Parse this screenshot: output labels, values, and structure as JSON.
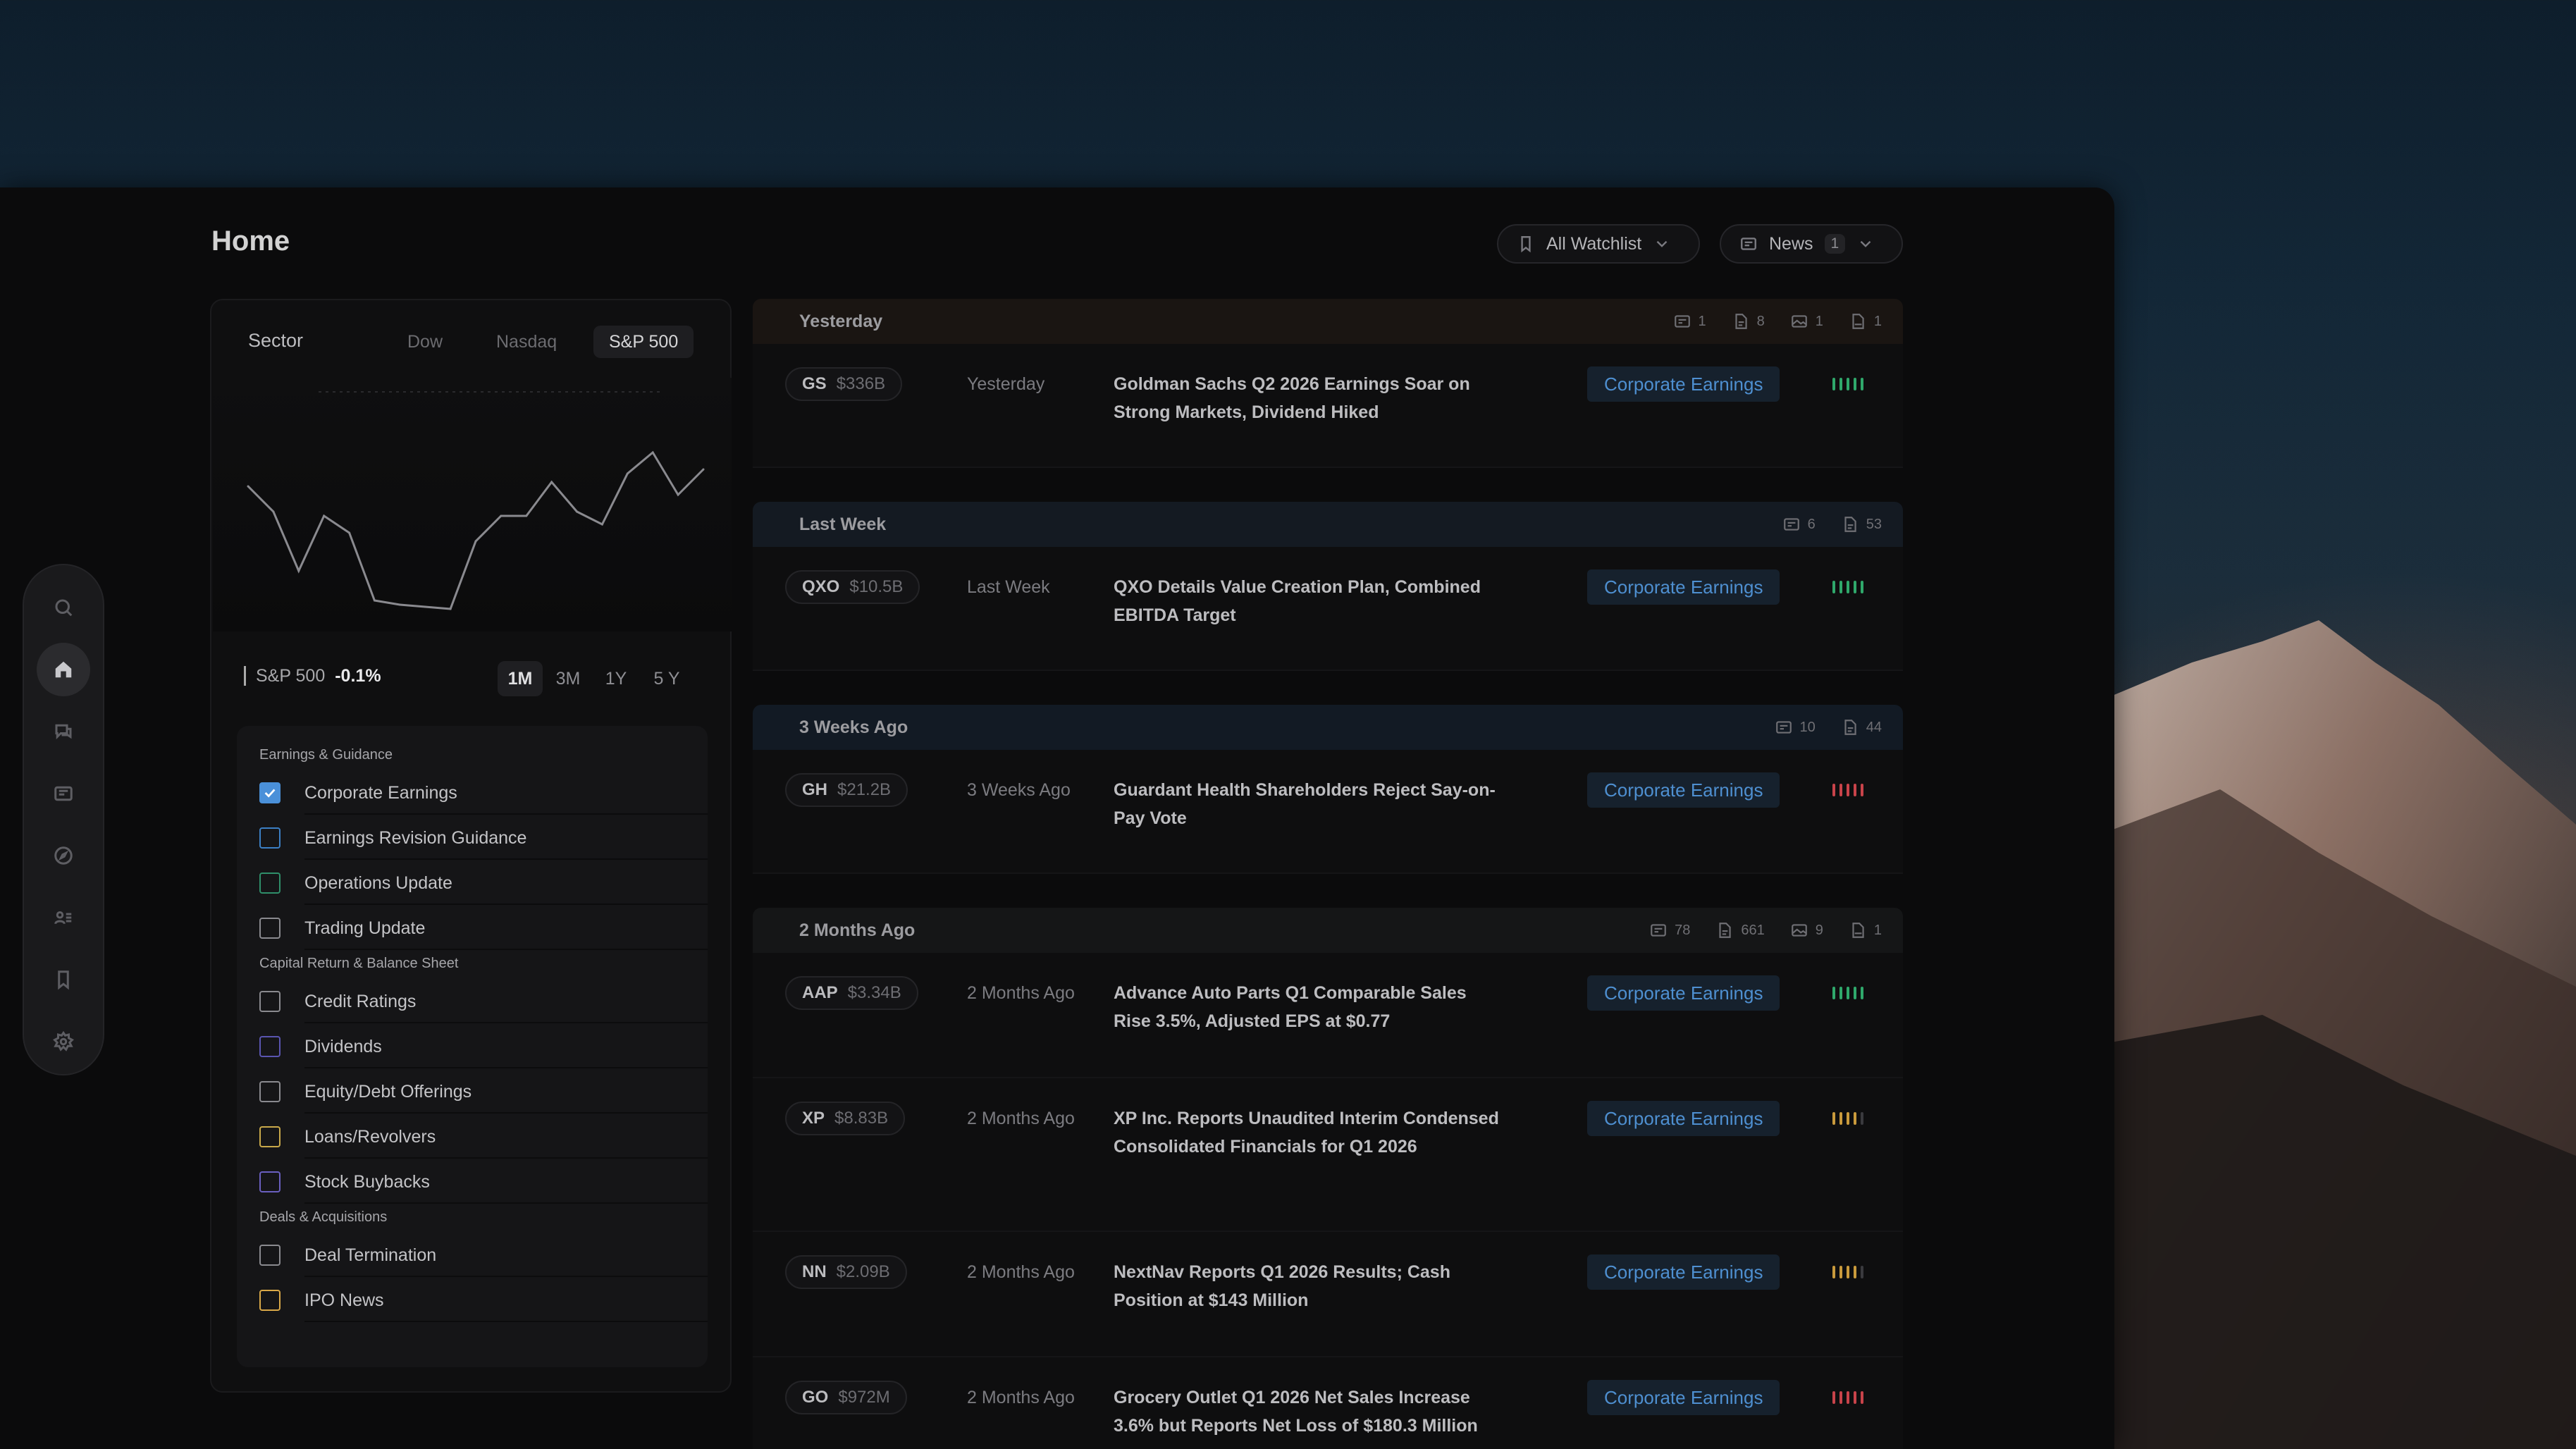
{
  "page": {
    "title": "Home"
  },
  "rail": {
    "icons": [
      "search-icon",
      "home-icon",
      "chat-icon",
      "news-icon",
      "compass-icon",
      "users-list-icon",
      "bookmark-icon",
      "settings-icon"
    ],
    "active": "home-icon"
  },
  "toolbar": {
    "watchlist_label": "All Watchlist",
    "news_label": "News",
    "news_count": "1"
  },
  "sector": {
    "label": "Sector",
    "tabs": [
      "Dow",
      "Nasdaq",
      "S&P 500"
    ],
    "active_tab": "S&P 500",
    "index_name": "S&P 500",
    "index_change": "-0.1%",
    "ranges": [
      "1M",
      "3M",
      "1Y",
      "5 Y"
    ],
    "active_range": "1M"
  },
  "chart_data": {
    "type": "line",
    "title": "",
    "xlabel": "",
    "ylabel": "",
    "values": [
      62,
      50,
      22,
      48,
      40,
      8,
      6,
      5,
      4,
      36,
      48,
      48,
      64,
      50,
      44,
      68,
      78,
      58,
      70
    ],
    "ylim": [
      0,
      100
    ],
    "grid": false
  },
  "filters": {
    "groups": [
      {
        "title": "Earnings & Guidance",
        "items": [
          {
            "label": "Corporate Earnings",
            "checked": true,
            "color": "#4a90d9"
          },
          {
            "label": "Earnings Revision Guidance",
            "checked": false,
            "color": "#3b7fc4"
          },
          {
            "label": "Operations Update",
            "checked": false,
            "color": "#2f8f6a"
          },
          {
            "label": "Trading Update",
            "checked": false,
            "color": "#8a8a8f"
          }
        ]
      },
      {
        "title": "Capital Return & Balance Sheet",
        "items": [
          {
            "label": "Credit Ratings",
            "checked": false,
            "color": "#8a8a8f"
          },
          {
            "label": "Dividends",
            "checked": false,
            "color": "#5a55b0"
          },
          {
            "label": "Equity/Debt Offerings",
            "checked": false,
            "color": "#8a8a8f"
          },
          {
            "label": "Loans/Revolvers",
            "checked": false,
            "color": "#c9a94a"
          },
          {
            "label": "Stock Buybacks",
            "checked": false,
            "color": "#6a5fc0"
          }
        ]
      },
      {
        "title": "Deals & Acquisitions",
        "items": [
          {
            "label": "Deal Termination",
            "checked": false,
            "color": "#8a8a8f"
          },
          {
            "label": "IPO News",
            "checked": false,
            "color": "#d9a848"
          }
        ]
      }
    ]
  },
  "news_groups": [
    {
      "header": "Yesterday",
      "tint": "#1a1512",
      "counts": [
        {
          "icon": "newspaper-icon",
          "value": "1"
        },
        {
          "icon": "document-icon",
          "value": "8"
        },
        {
          "icon": "image-icon",
          "value": "1"
        },
        {
          "icon": "pdf-icon",
          "value": "1"
        }
      ],
      "rows": [
        {
          "symbol": "GS",
          "cap": "$336B",
          "when": "Yesterday",
          "headline": "Goldman Sachs Q2 2026 Earnings Soar on Strong Markets, Dividend Hiked",
          "tag": "Corporate Earnings",
          "sentiment": "positive"
        }
      ]
    },
    {
      "header": "Last Week",
      "tint": "#141a22",
      "counts": [
        {
          "icon": "newspaper-icon",
          "value": "6"
        },
        {
          "icon": "document-icon",
          "value": "53"
        }
      ],
      "rows": [
        {
          "symbol": "QXO",
          "cap": "$10.5B",
          "when": "Last Week",
          "headline": "QXO Details Value Creation Plan, Combined EBITDA Target",
          "tag": "Corporate Earnings",
          "sentiment": "positive"
        }
      ]
    },
    {
      "header": "3 Weeks Ago",
      "tint": "#121a24",
      "counts": [
        {
          "icon": "newspaper-icon",
          "value": "10"
        },
        {
          "icon": "document-icon",
          "value": "44"
        }
      ],
      "rows": [
        {
          "symbol": "GH",
          "cap": "$21.2B",
          "when": "3 Weeks Ago",
          "headline": "Guardant Health Shareholders Reject Say-on-Pay Vote",
          "tag": "Corporate Earnings",
          "sentiment": "negative"
        }
      ]
    },
    {
      "header": "2 Months Ago",
      "tint": "#151617",
      "counts": [
        {
          "icon": "newspaper-icon",
          "value": "78"
        },
        {
          "icon": "document-icon",
          "value": "661"
        },
        {
          "icon": "image-icon",
          "value": "9"
        },
        {
          "icon": "pdf-icon",
          "value": "1"
        }
      ],
      "rows": [
        {
          "symbol": "AAP",
          "cap": "$3.34B",
          "when": "2 Months Ago",
          "headline": "Advance Auto Parts Q1 Comparable Sales Rise 3.5%, Adjusted EPS at $0.77",
          "tag": "Corporate Earnings",
          "sentiment": "positive"
        },
        {
          "symbol": "XP",
          "cap": "$8.83B",
          "when": "2 Months Ago",
          "headline": "XP Inc. Reports Unaudited Interim Condensed Consolidated Financials for Q1 2026",
          "tag": "Corporate Earnings",
          "sentiment": "neutral"
        },
        {
          "symbol": "NN",
          "cap": "$2.09B",
          "when": "2 Months Ago",
          "headline": "NextNav Reports Q1 2026 Results; Cash Position at $143 Million",
          "tag": "Corporate Earnings",
          "sentiment": "neutral"
        },
        {
          "symbol": "GO",
          "cap": "$972M",
          "when": "2 Months Ago",
          "headline": "Grocery Outlet Q1 2026 Net Sales Increase 3.6% but Reports Net Loss of $180.3 Million",
          "tag": "Corporate Earnings",
          "sentiment": "negative"
        }
      ]
    }
  ],
  "colors": {
    "positive": "#2fa86b",
    "negative": "#c8434a",
    "neutral": "#c99a3c",
    "accent": "#4e8fd0"
  }
}
